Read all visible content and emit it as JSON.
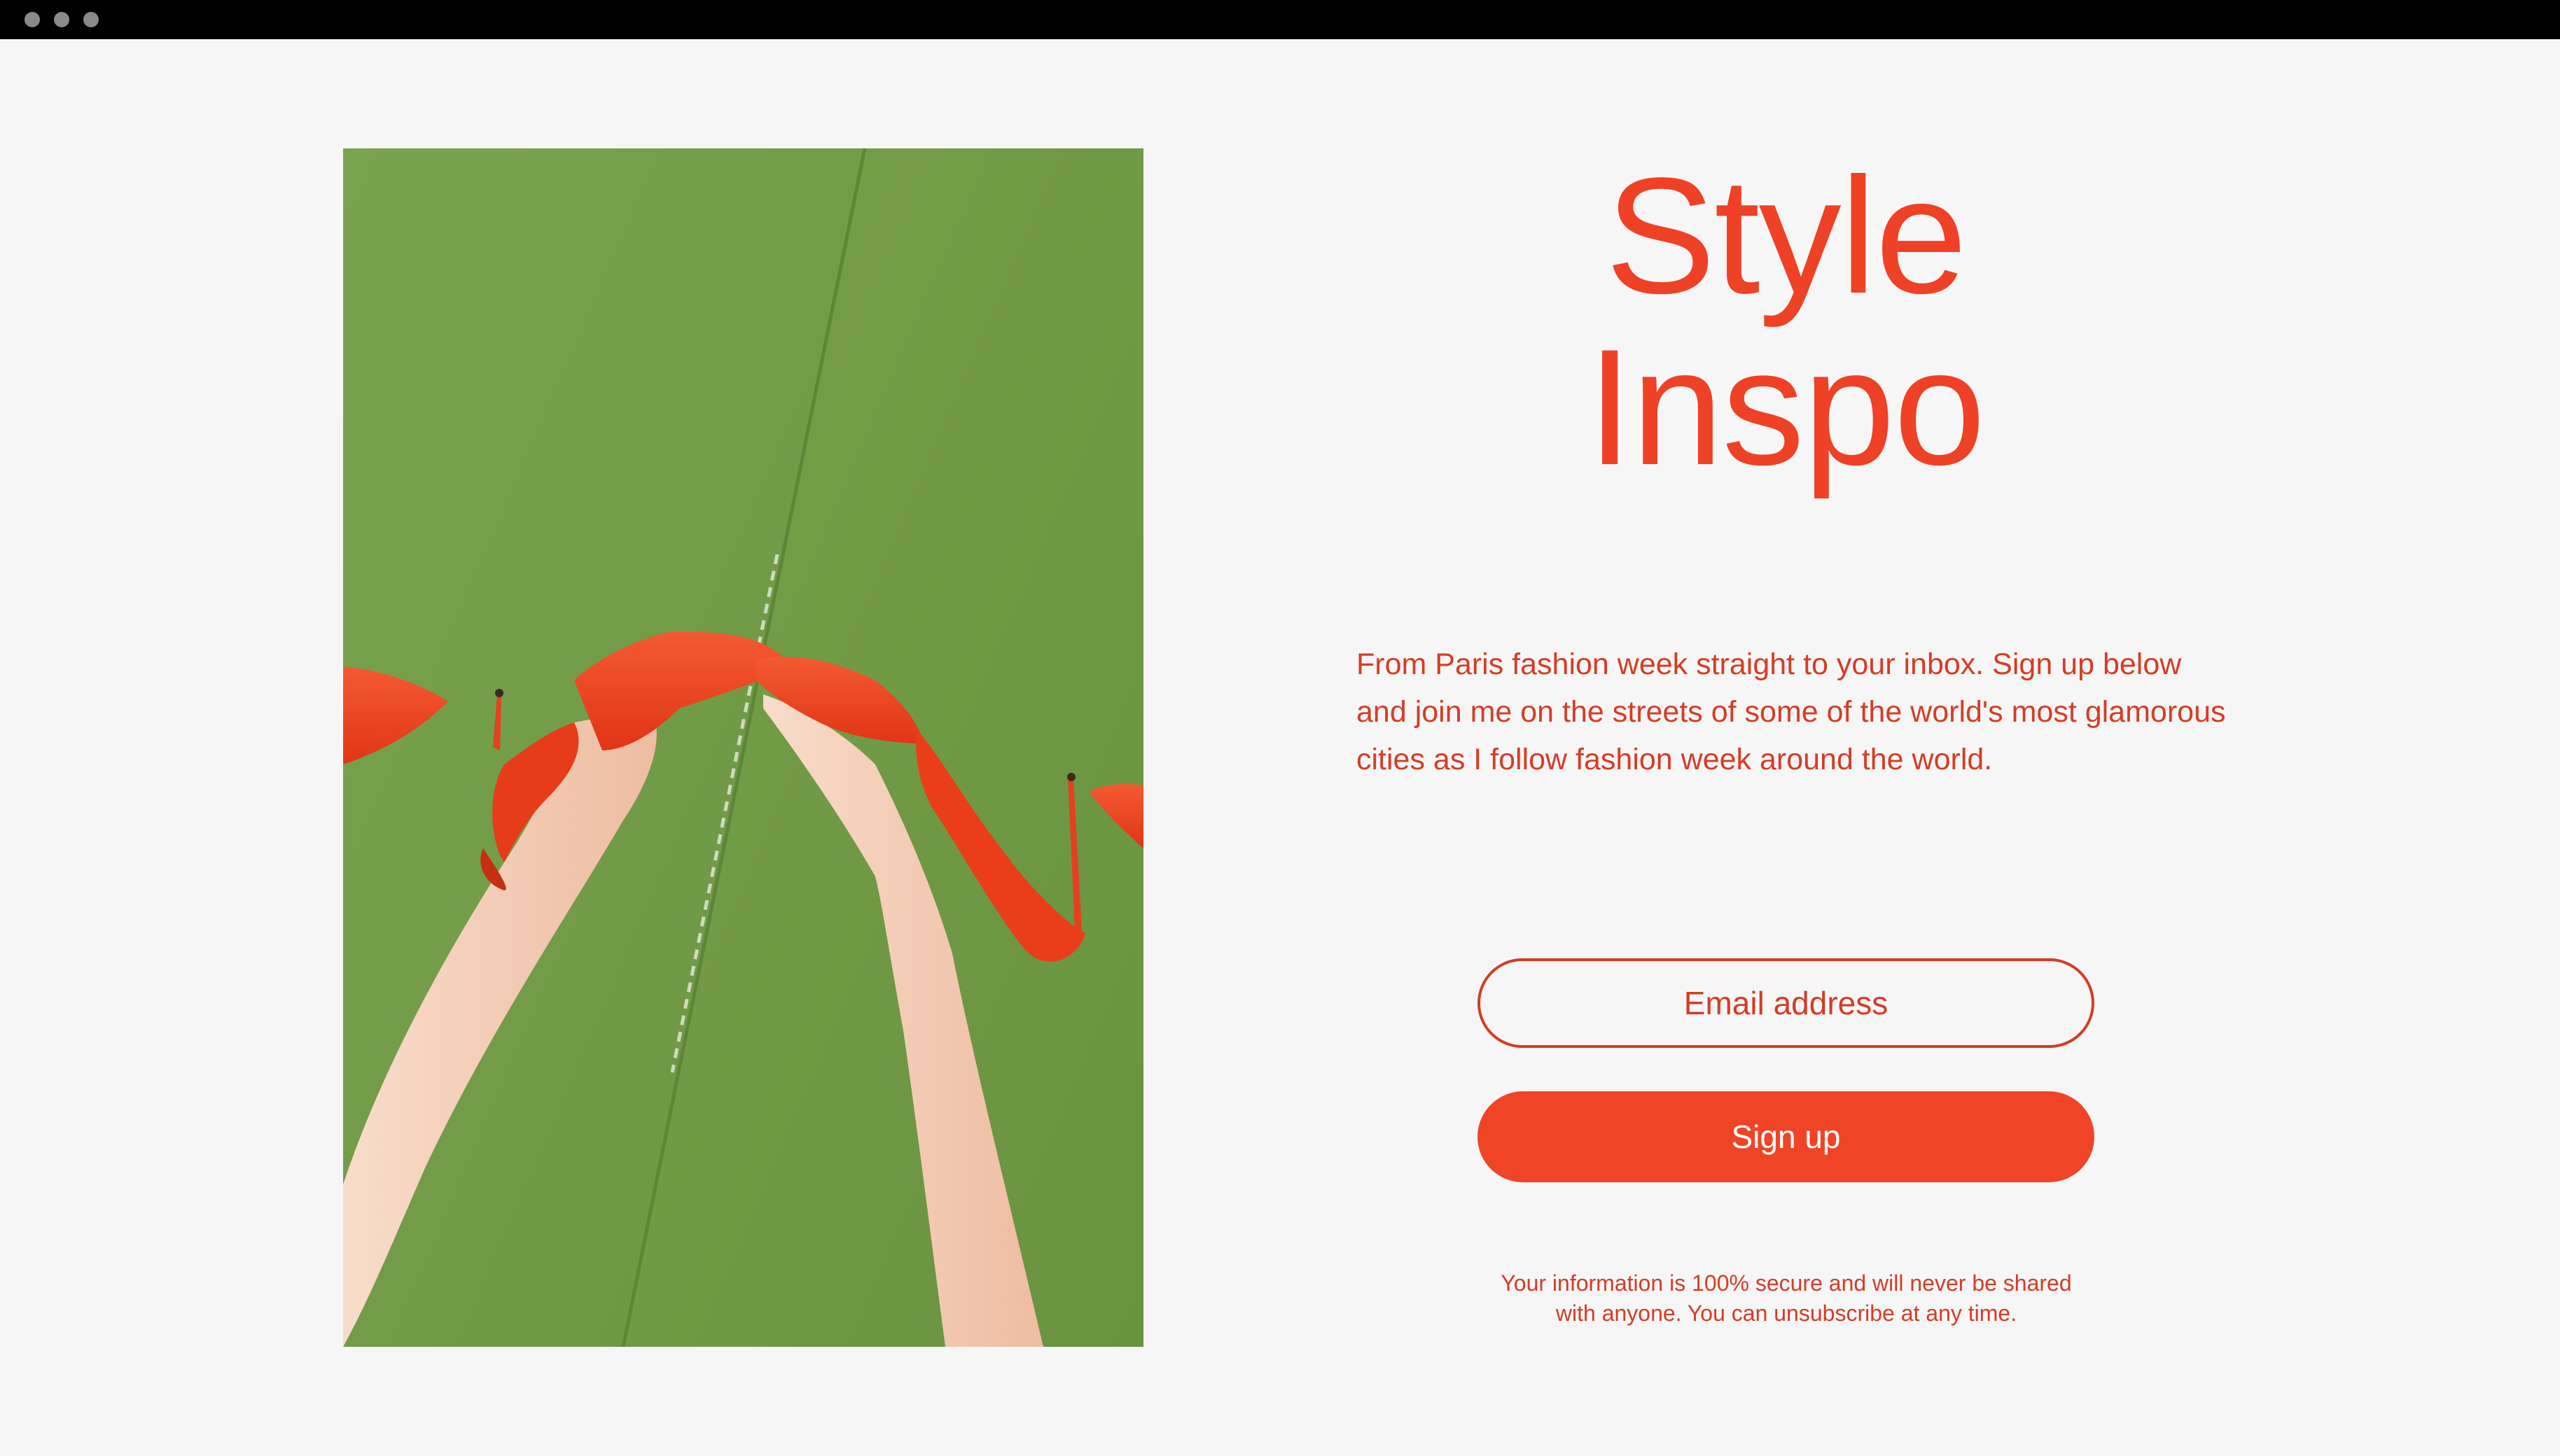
{
  "window": {
    "controls": [
      "window-dot",
      "window-dot",
      "window-dot"
    ]
  },
  "hero_image": {
    "alt": "Legs wearing red suede high heels on a green carpet",
    "colors": {
      "carpet": "#6f9a45",
      "shoe": "#ef3c1f",
      "skin": "#f3cdb6"
    }
  },
  "headline": {
    "line1": "Style",
    "line2": "Inspo"
  },
  "intro": {
    "text": "From Paris fashion week straight to your inbox. Sign up below and join me on the streets of some of the world's most glamorous cities as I follow fashion week around the world."
  },
  "form": {
    "email_placeholder": "Email address",
    "email_value": "",
    "submit_label": "Sign up"
  },
  "disclaimer": {
    "line1": "Your information is 100% secure and will never be shared",
    "line2": "with anyone. You can unsubscribe at any time."
  },
  "colors": {
    "accent": "#f04426",
    "text_accent": "#d63c26",
    "background": "#f6f6f6",
    "titlebar": "#000000"
  }
}
